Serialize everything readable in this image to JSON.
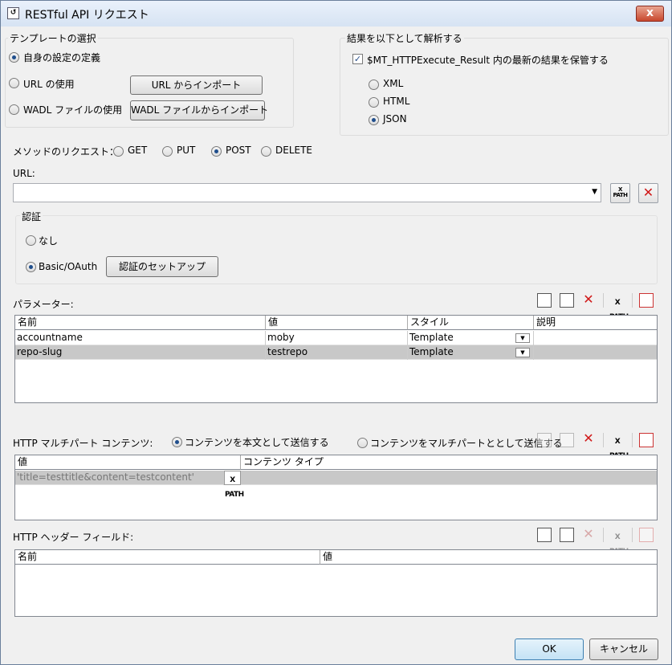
{
  "window": {
    "title": "RESTful API リクエスト",
    "close_glyph": "x"
  },
  "template_group": {
    "title": "テンプレートの選択",
    "options": [
      {
        "label": "自身の設定の定義",
        "selected": true
      },
      {
        "label": "URL の使用",
        "selected": false
      },
      {
        "label": "WADL ファイルの使用",
        "selected": false
      }
    ],
    "import_url_button": "URL からインポート",
    "import_wadl_button": "WADL ファイルからインポート"
  },
  "result_group": {
    "title": "結果を以下として解析する",
    "store_latest_label": "$MT_HTTPExecute_Result 内の最新の結果を保管する",
    "store_latest_checked": true,
    "formats": [
      {
        "label": "XML",
        "selected": false
      },
      {
        "label": "HTML",
        "selected": false
      },
      {
        "label": "JSON",
        "selected": true
      }
    ]
  },
  "method": {
    "label": "メソッドのリクエスト：",
    "options": [
      {
        "label": "GET",
        "selected": false
      },
      {
        "label": "PUT",
        "selected": false
      },
      {
        "label": "POST",
        "selected": true
      },
      {
        "label": "DELETE",
        "selected": false
      }
    ]
  },
  "url": {
    "label": "URL:",
    "value": "",
    "xpath_label": [
      "X",
      "PATH"
    ]
  },
  "auth": {
    "title": "認証",
    "none_label": "なし",
    "basic_label": "Basic/OAuth",
    "none_selected": false,
    "basic_selected": true,
    "setup_button": "認証のセットアップ"
  },
  "parameters": {
    "label": "パラメーター:",
    "columns": [
      "名前",
      "値",
      "スタイル",
      "説明"
    ],
    "rows": [
      {
        "name": "accountname",
        "value": "moby",
        "style": "Template",
        "description": ""
      },
      {
        "name": "repo-slug",
        "value": "testrepo",
        "style": "Template",
        "description": ""
      }
    ]
  },
  "multipart": {
    "label": "HTTP マルチパート  コンテンツ:",
    "option_body": "コンテンツを本文として送信する",
    "option_multipart": "コンテンツをマルチパートととして送信する",
    "body_selected": true,
    "columns": [
      "値",
      "コンテンツ タイプ"
    ],
    "rows": [
      {
        "value": "'title=testtitle&content=testcontent'",
        "content_type": ""
      }
    ]
  },
  "headers": {
    "label": "HTTP ヘッダー フィールド:",
    "columns": [
      "名前",
      "値"
    ],
    "rows": []
  },
  "footer": {
    "ok": "OK",
    "cancel": "キャンセル"
  },
  "colors": {
    "accent": "#1f4e8c",
    "selected_row": "#c8c8c8",
    "delete_red": "#d01818"
  }
}
